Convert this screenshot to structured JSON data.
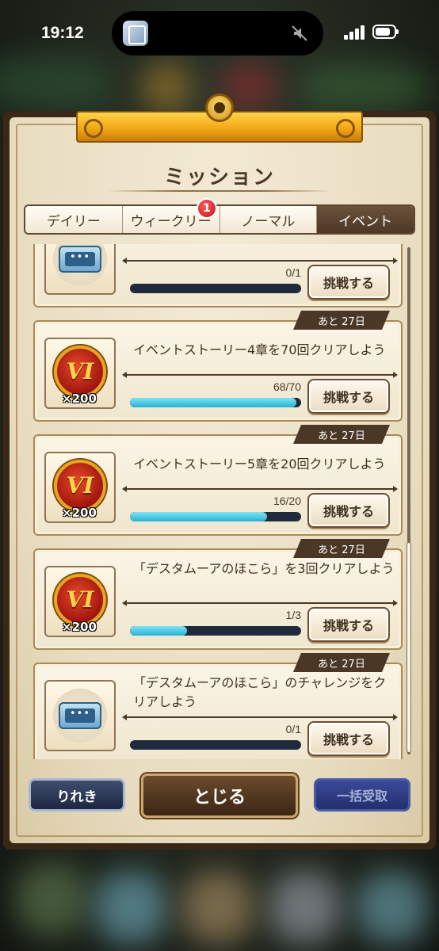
{
  "status_bar": {
    "time": "19:12"
  },
  "panel": {
    "title": "ミッション",
    "tabs": [
      {
        "label": "デイリー",
        "active": false
      },
      {
        "label": "ウィークリー",
        "active": false,
        "badge": "1"
      },
      {
        "label": "ノーマル",
        "active": false
      },
      {
        "label": "イベント",
        "active": true
      }
    ]
  },
  "missions": [
    {
      "text": "",
      "reward_icon": "ticket-icon",
      "reward_count": "",
      "days": "",
      "progress_text": "0/1",
      "progress": 0,
      "button": "挑戦する"
    },
    {
      "text": "イベントストーリー4章を70回クリアしよう",
      "reward_icon": "medal-icon",
      "medal_text": "VI",
      "reward_count": "×200",
      "days": "あと 27日",
      "progress_text": "68/70",
      "progress": 0.971,
      "button": "挑戦する"
    },
    {
      "text": "イベントストーリー5章を20回クリアしよう",
      "reward_icon": "medal-icon",
      "medal_text": "VI",
      "reward_count": "×200",
      "days": "あと 27日",
      "progress_text": "16/20",
      "progress": 0.8,
      "button": "挑戦する"
    },
    {
      "text": "「デスタムーアのほこら」を3回クリアしよう",
      "reward_icon": "medal-icon",
      "medal_text": "VI",
      "reward_count": "×200",
      "days": "あと 27日",
      "progress_text": "1/3",
      "progress": 0.333,
      "button": "挑戦する"
    },
    {
      "text": "「デスタムーアのほこら」のチャレンジをクリアしよう",
      "reward_icon": "ticket-icon",
      "reward_count": "",
      "days": "あと 27日",
      "progress_text": "0/1",
      "progress": 0,
      "button": "挑戦する"
    }
  ],
  "footer": {
    "history_label": "りれき",
    "close_label": "とじる",
    "claim_all_label": "一括受取"
  }
}
